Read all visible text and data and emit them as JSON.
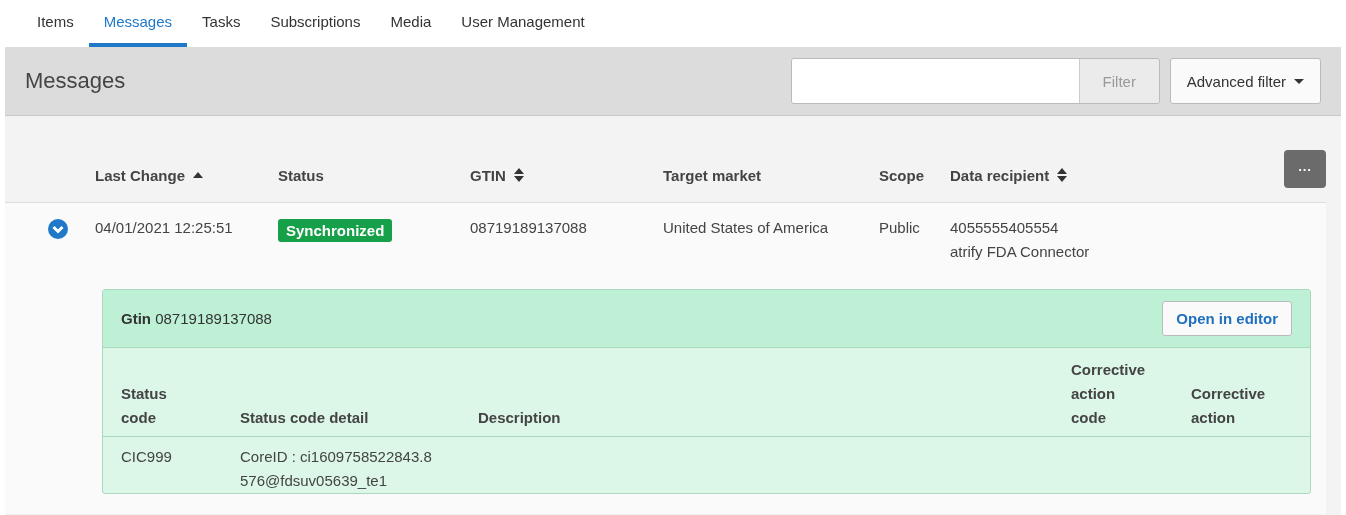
{
  "tabs": [
    {
      "label": "Items",
      "selected": false
    },
    {
      "label": "Messages",
      "selected": true
    },
    {
      "label": "Tasks",
      "selected": false
    },
    {
      "label": "Subscriptions",
      "selected": false
    },
    {
      "label": "Media",
      "selected": false
    },
    {
      "label": "User Management",
      "selected": false
    }
  ],
  "page_title": "Messages",
  "filter": {
    "button": "Filter",
    "advanced": "Advanced filter"
  },
  "table": {
    "columns": [
      {
        "label": "Last Change",
        "sorted": true
      },
      {
        "label": "Status",
        "sortable": false
      },
      {
        "label": "GTIN",
        "sorted": false,
        "sortable": true
      },
      {
        "label": "Target market",
        "sortable": false
      },
      {
        "label": "Scope",
        "sortable": false
      },
      {
        "label": "Data recipient",
        "sorted": false,
        "sortable": true
      }
    ],
    "more_button": "···",
    "rows": [
      {
        "expanded": true,
        "last_change": "04/01/2021 12:25:51",
        "status": "Synchronized",
        "gtin": "08719189137088",
        "target_market": "United States of America",
        "scope": "Public",
        "recipient_id": "4055555405554",
        "recipient_name": "atrify FDA Connector",
        "detail": {
          "title": "**Gtin** 08719189137088",
          "open_button": "Open in editor",
          "columns": [
            "Status code",
            "Status code detail",
            "Description",
            "Corrective action code",
            "Corrective action"
          ],
          "rows": [
            [
              "CIC999",
              "CoreID : ci1609758522843.8576@fdsuv05639_te1",
              "",
              "",
              ""
            ]
          ]
        }
      }
    ]
  }
}
